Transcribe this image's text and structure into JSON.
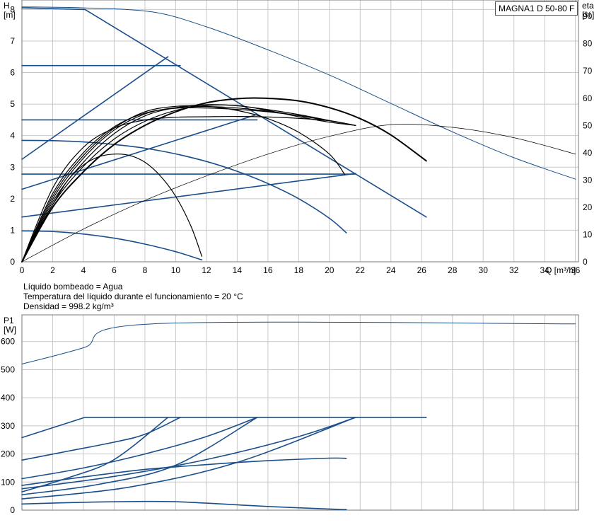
{
  "pump_title": "MAGNA1 D 50-80 F",
  "info_lines": [
    "Líquido bombeado = Agua",
    "Temperatura del líquido durante el funcionamiento = 20 °C",
    "Densidad = 998.2 kg/m³"
  ],
  "colors": {
    "blue": "#1a4f8b",
    "black": "#000000",
    "grid": "#c8c8c8"
  },
  "chart_data": [
    {
      "type": "line",
      "title": "MAGNA1 D 50-80 F",
      "xlabel": "Q [m³/h]",
      "ylabel": "H\n[m]",
      "y2label": "eta\n[%]",
      "xlim": [
        0,
        36.2
      ],
      "ylim": [
        0,
        8.3
      ],
      "y2lim": [
        0,
        96
      ],
      "xticks": [
        0,
        2,
        4,
        6,
        8,
        10,
        12,
        14,
        16,
        18,
        20,
        22,
        24,
        26,
        28,
        30,
        32,
        34,
        36
      ],
      "yticks": [
        0,
        1,
        2,
        3,
        4,
        5,
        6,
        7,
        8
      ],
      "y2ticks": [
        0,
        10,
        20,
        30,
        40,
        50,
        60,
        70,
        80,
        90
      ],
      "grid": true,
      "series": [
        {
          "kind": "head",
          "color": "blue",
          "width": 1.6,
          "points": [
            [
              0,
              8.05
            ],
            [
              4.1,
              8.0
            ],
            [
              26.3,
              1.42
            ]
          ]
        },
        {
          "kind": "head",
          "color": "blue",
          "width": 1.6,
          "points": [
            [
              0,
              6.22
            ],
            [
              10.3,
              6.22
            ]
          ]
        },
        {
          "kind": "head",
          "color": "blue",
          "width": 1.6,
          "points": [
            [
              0,
              4.5
            ],
            [
              15.3,
              4.5
            ]
          ]
        },
        {
          "kind": "head",
          "color": "blue",
          "width": 1.6,
          "points": [
            [
              0,
              2.78
            ],
            [
              21.7,
              2.78
            ]
          ]
        },
        {
          "kind": "head",
          "color": "blue",
          "width": 1.6,
          "points": [
            [
              0,
              3.25
            ],
            [
              9.5,
              6.5
            ]
          ]
        },
        {
          "kind": "head",
          "color": "blue",
          "width": 1.6,
          "points": [
            [
              0,
              2.3
            ],
            [
              15.3,
              4.67
            ]
          ]
        },
        {
          "kind": "head",
          "color": "blue",
          "width": 1.6,
          "points": [
            [
              0,
              1.42
            ],
            [
              21.7,
              2.8
            ]
          ]
        },
        {
          "kind": "head",
          "color": "blue",
          "width": 1.6,
          "points": [
            [
              0,
              3.85
            ],
            [
              2,
              3.84
            ],
            [
              4,
              3.8
            ],
            [
              6,
              3.72
            ],
            [
              8,
              3.6
            ],
            [
              10,
              3.42
            ],
            [
              12,
              3.18
            ],
            [
              14,
              2.87
            ],
            [
              16,
              2.48
            ],
            [
              18,
              2.0
            ],
            [
              20,
              1.38
            ],
            [
              21.1,
              0.92
            ]
          ]
        },
        {
          "kind": "head",
          "color": "blue",
          "width": 1.6,
          "points": [
            [
              0,
              0.98
            ],
            [
              2,
              0.96
            ],
            [
              4,
              0.88
            ],
            [
              6,
              0.75
            ],
            [
              8,
              0.56
            ],
            [
              10,
              0.32
            ],
            [
              11.7,
              0.06
            ]
          ]
        },
        {
          "kind": "head",
          "color": "blue",
          "width": 1.0,
          "points": [
            [
              0,
              8.08
            ],
            [
              4,
              8.05
            ],
            [
              8.5,
              7.92
            ],
            [
              12,
              7.45
            ],
            [
              16,
              6.72
            ],
            [
              20,
              5.92
            ],
            [
              24,
              5.02
            ],
            [
              28,
              4.12
            ],
            [
              32,
              3.3
            ],
            [
              36,
              2.62
            ]
          ]
        },
        {
          "kind": "eta",
          "color": "black",
          "width": 2.0,
          "points": [
            [
              0,
              0
            ],
            [
              2,
              20
            ],
            [
              4,
              33
            ],
            [
              6,
              43
            ],
            [
              8,
              50
            ],
            [
              10,
              55
            ],
            [
              12,
              58.3
            ],
            [
              14,
              59.8
            ],
            [
              15.7,
              60
            ],
            [
              18,
              59
            ],
            [
              20,
              56.5
            ],
            [
              22,
              52.5
            ],
            [
              24,
              46.5
            ],
            [
              26.3,
              37
            ]
          ]
        },
        {
          "kind": "eta",
          "color": "black",
          "width": 1.2,
          "points": [
            [
              0,
              0
            ],
            [
              2,
              21
            ],
            [
              4,
              35
            ],
            [
              6,
              45
            ],
            [
              8,
              51.5
            ],
            [
              10,
              55.5
            ],
            [
              12,
              57.3
            ],
            [
              14,
              57.3
            ],
            [
              16,
              55.5
            ],
            [
              18,
              53.2
            ],
            [
              20,
              51.2
            ],
            [
              21.7,
              50
            ]
          ]
        },
        {
          "kind": "eta",
          "color": "black",
          "width": 1.2,
          "points": [
            [
              0,
              0
            ],
            [
              2,
              22
            ],
            [
              4,
              36.5
            ],
            [
              6,
              47
            ],
            [
              8,
              53.5
            ],
            [
              10,
              56.5
            ],
            [
              12,
              57.6
            ],
            [
              14,
              57.2
            ],
            [
              16,
              55.8
            ],
            [
              18,
              54
            ],
            [
              20,
              51.8
            ],
            [
              21.7,
              50
            ]
          ]
        },
        {
          "kind": "eta",
          "color": "black",
          "width": 1.2,
          "points": [
            [
              0,
              0
            ],
            [
              2,
              23
            ],
            [
              4,
              38
            ],
            [
              6,
              48.3
            ],
            [
              8,
              54.2
            ],
            [
              10,
              56.5
            ],
            [
              12,
              56.9
            ],
            [
              14,
              56.4
            ],
            [
              16,
              55.2
            ],
            [
              18,
              53.6
            ],
            [
              20,
              51.7
            ],
            [
              21.7,
              50
            ]
          ]
        },
        {
          "kind": "eta",
          "color": "black",
          "width": 1.2,
          "points": [
            [
              0,
              0
            ],
            [
              2,
              25
            ],
            [
              4,
              40
            ],
            [
              6,
              49.5
            ],
            [
              8,
              54.5
            ],
            [
              10,
              56.3
            ],
            [
              12,
              56.4
            ],
            [
              14,
              55.9
            ],
            [
              16,
              55
            ],
            [
              18,
              53.6
            ],
            [
              20,
              51.8
            ],
            [
              21.7,
              50
            ]
          ]
        },
        {
          "kind": "eta",
          "color": "black",
          "width": 1.2,
          "points": [
            [
              0,
              0
            ],
            [
              2,
              27
            ],
            [
              4,
              42
            ],
            [
              6,
              49
            ],
            [
              8,
              52
            ],
            [
              10,
              53
            ],
            [
              12,
              53.2
            ],
            [
              14,
              53.3
            ],
            [
              16,
              53.1
            ],
            [
              18,
              52.6
            ],
            [
              20,
              51.7
            ],
            [
              21.7,
              50
            ]
          ]
        },
        {
          "kind": "eta",
          "color": "black",
          "width": 1.2,
          "points": [
            [
              0,
              0
            ],
            [
              2,
              24
            ],
            [
              4,
              39
            ],
            [
              6,
              49
            ],
            [
              8,
              55
            ],
            [
              10,
              57
            ],
            [
              12,
              57
            ],
            [
              14,
              55.5
            ],
            [
              16,
              52.5
            ],
            [
              18,
              47.5
            ],
            [
              20,
              39.5
            ],
            [
              21,
              32
            ]
          ]
        },
        {
          "kind": "eta",
          "color": "black",
          "width": 1.2,
          "points": [
            [
              0,
              0
            ],
            [
              1,
              11
            ],
            [
              2,
              21
            ],
            [
              3,
              30
            ],
            [
              4,
              35.5
            ],
            [
              5,
              38.5
            ],
            [
              6,
              39.5
            ],
            [
              7,
              39
            ],
            [
              8,
              36.5
            ],
            [
              9,
              31.5
            ],
            [
              10,
              24
            ],
            [
              11,
              13
            ],
            [
              11.7,
              2
            ]
          ]
        },
        {
          "kind": "eta",
          "color": "black",
          "width": 0.7,
          "points": [
            [
              0,
              0
            ],
            [
              4,
              12
            ],
            [
              8,
              22.5
            ],
            [
              12,
              31.5
            ],
            [
              16,
              39.5
            ],
            [
              20,
              46
            ],
            [
              24,
              50.3
            ],
            [
              28,
              49.3
            ],
            [
              32,
              45.5
            ],
            [
              36,
              39.5
            ]
          ]
        }
      ]
    },
    {
      "type": "line",
      "xlabel": "",
      "ylabel": "P1\n[W]",
      "xlim": [
        0,
        36.2
      ],
      "ylim": [
        0,
        695
      ],
      "yticks": [
        0,
        100,
        200,
        300,
        400,
        500,
        600
      ],
      "grid": true,
      "series": [
        {
          "color": "blue",
          "width": 1.0,
          "points": [
            [
              0,
              520
            ],
            [
              4,
              578
            ],
            [
              8.5,
              663
            ],
            [
              36,
              663
            ]
          ]
        },
        {
          "color": "blue",
          "width": 1.6,
          "points": [
            [
              0,
              258
            ],
            [
              4.1,
              330
            ],
            [
              26.3,
              330
            ]
          ]
        },
        {
          "color": "blue",
          "width": 1.6,
          "points": [
            [
              0,
              178
            ],
            [
              3,
              210
            ],
            [
              6,
              242
            ],
            [
              8,
              270
            ],
            [
              10.3,
              330
            ]
          ]
        },
        {
          "color": "blue",
          "width": 1.6,
          "points": [
            [
              0,
              112
            ],
            [
              4,
              150
            ],
            [
              8,
              200
            ],
            [
              12,
              262
            ],
            [
              15.3,
              330
            ]
          ]
        },
        {
          "color": "blue",
          "width": 1.6,
          "points": [
            [
              0,
              76
            ],
            [
              6,
              120
            ],
            [
              12,
              180
            ],
            [
              18,
              262
            ],
            [
              21.7,
              330
            ]
          ]
        },
        {
          "color": "blue",
          "width": 1.6,
          "points": [
            [
              0,
              65
            ],
            [
              3,
              115
            ],
            [
              6,
              180
            ],
            [
              9.5,
              330
            ]
          ]
        },
        {
          "color": "blue",
          "width": 1.6,
          "points": [
            [
              0,
              55
            ],
            [
              5,
              92
            ],
            [
              10,
              160
            ],
            [
              15.3,
              330
            ]
          ]
        },
        {
          "color": "blue",
          "width": 1.6,
          "points": [
            [
              0,
              40
            ],
            [
              7,
              82
            ],
            [
              14,
              170
            ],
            [
              21.7,
              330
            ]
          ]
        },
        {
          "color": "blue",
          "width": 1.6,
          "points": [
            [
              0,
              88
            ],
            [
              4,
              118
            ],
            [
              8,
              145
            ],
            [
              12,
              162
            ],
            [
              16,
              176
            ],
            [
              20,
              185
            ],
            [
              21.1,
              184
            ]
          ]
        },
        {
          "color": "blue",
          "width": 1.6,
          "points": [
            [
              0,
              22
            ],
            [
              4,
              28
            ],
            [
              8,
              31
            ],
            [
              10,
              30
            ],
            [
              12,
              25
            ],
            [
              16,
              13
            ],
            [
              20,
              4
            ],
            [
              21.1,
              2
            ]
          ]
        }
      ]
    }
  ]
}
